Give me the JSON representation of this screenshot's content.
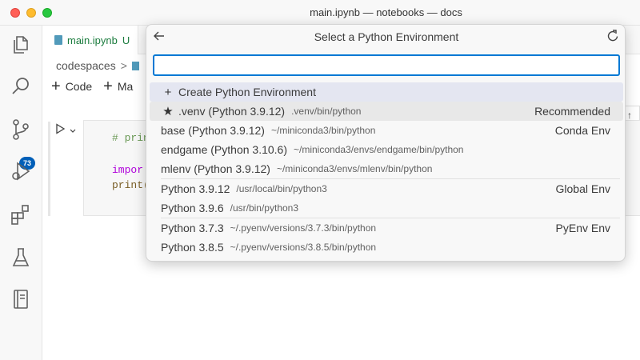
{
  "window": {
    "title": "main.ipynb — notebooks — docs"
  },
  "activity_bar": {
    "items": [
      {
        "name": "explorer",
        "icon": "files-icon"
      },
      {
        "name": "search",
        "icon": "search-icon"
      },
      {
        "name": "source-control",
        "icon": "source-control-icon",
        "badge": "73"
      },
      {
        "name": "run-debug",
        "icon": "debug-icon"
      },
      {
        "name": "extensions",
        "icon": "extensions-icon"
      },
      {
        "name": "testing",
        "icon": "beaker-icon"
      },
      {
        "name": "notebook",
        "icon": "notebook-icon"
      }
    ]
  },
  "editor": {
    "tab": {
      "label": "main.ipynb",
      "status": "U"
    },
    "breadcrumb": {
      "root": "codespaces",
      "separator": ">"
    },
    "toolbar": {
      "code_label": "Code",
      "markdown_label": "Ma"
    },
    "cell": {
      "lines": [
        {
          "comment": "# prin"
        },
        {
          "keyword": "impor"
        },
        {
          "fn": "print("
        }
      ]
    },
    "right_button_glyph": "↑"
  },
  "quick_pick": {
    "title": "Select a Python Environment",
    "input": {
      "value": "",
      "placeholder": ""
    },
    "create_label": "Create Python Environment",
    "groups": [
      {
        "items": [
          {
            "label": ".venv (Python 3.9.12)",
            "desc": ".venv/bin/python",
            "detail": "Recommended",
            "icon": "star-icon"
          }
        ]
      },
      {
        "items": [
          {
            "label": "base (Python 3.9.12)",
            "desc": "~/miniconda3/bin/python",
            "detail": "Conda Env"
          },
          {
            "label": "endgame (Python 3.10.6)",
            "desc": "~/miniconda3/envs/endgame/bin/python",
            "detail": ""
          },
          {
            "label": "mlenv (Python 3.9.12)",
            "desc": "~/miniconda3/envs/mlenv/bin/python",
            "detail": ""
          }
        ]
      },
      {
        "items": [
          {
            "label": "Python 3.9.12",
            "desc": "/usr/local/bin/python3",
            "detail": "Global Env"
          },
          {
            "label": "Python 3.9.6",
            "desc": "/usr/bin/python3",
            "detail": ""
          }
        ]
      },
      {
        "items": [
          {
            "label": "Python 3.7.3",
            "desc": "~/.pyenv/versions/3.7.3/bin/python",
            "detail": "PyEnv Env"
          },
          {
            "label": "Python 3.8.5",
            "desc": "~/.pyenv/versions/3.8.5/bin/python",
            "detail": ""
          }
        ]
      }
    ]
  },
  "colors": {
    "accent": "#0078d4",
    "badge": "#005fb8",
    "untracked_green": "#1b7c3e"
  }
}
